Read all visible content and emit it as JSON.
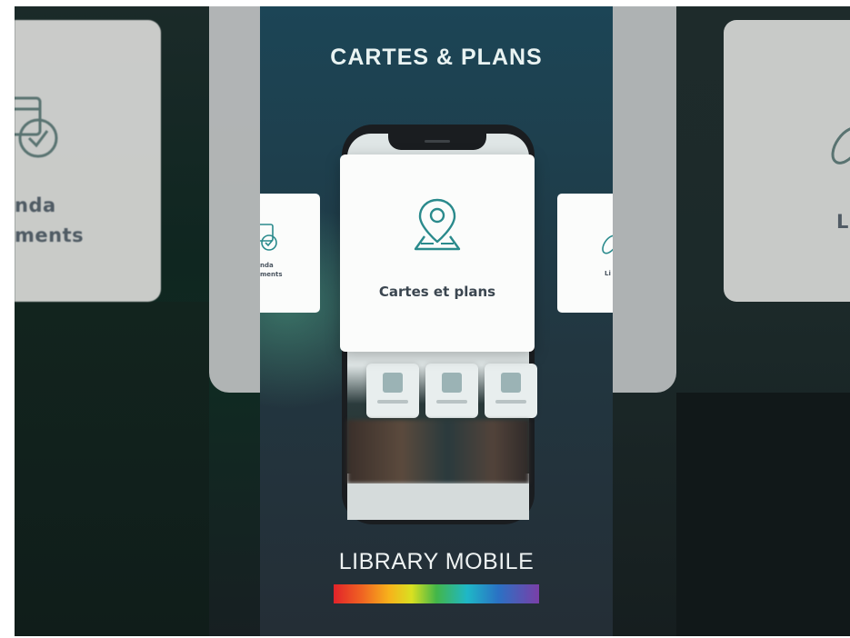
{
  "center": {
    "title": "CARTES & PLANS",
    "footer_title": "LIBRARY MOBILE"
  },
  "main_card": {
    "label": "Cartes et plans",
    "icon": "map-pin-icon"
  },
  "side_card_left": {
    "label_line1": "nda",
    "label_line2": "ments",
    "icon": "calendar-check-icon"
  },
  "side_card_right": {
    "label": "Li",
    "icon": "link-icon"
  },
  "bg_card_left": {
    "label_line1": "nda",
    "label_line2": "ments",
    "icon": "calendar-check-icon"
  },
  "bg_card_right": {
    "label": "L",
    "icon": "link-icon"
  },
  "colors": {
    "accent_teal": "#2a8a8c",
    "title_text": "#e9f3f2",
    "card_bg": "#fbfcfb"
  }
}
